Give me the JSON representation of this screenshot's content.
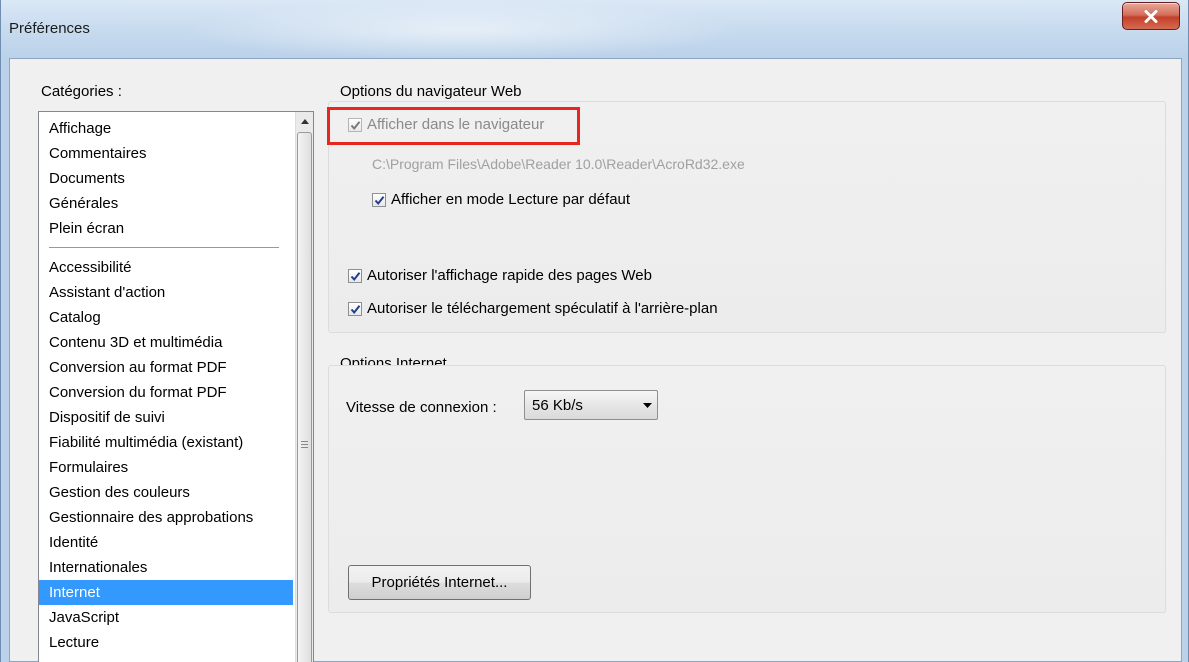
{
  "window": {
    "title": "Préférences"
  },
  "categories": {
    "label": "Catégories :",
    "group1": [
      "Affichage",
      "Commentaires",
      "Documents",
      "Générales",
      "Plein écran"
    ],
    "group2": [
      "Accessibilité",
      "Assistant d'action",
      "Catalog",
      "Contenu 3D et multimédia",
      "Conversion au format PDF",
      "Conversion du format PDF",
      "Dispositif de suivi",
      "Fiabilité multimédia (existant)",
      "Formulaires",
      "Gestion des couleurs",
      "Gestionnaire des approbations",
      "Identité",
      "Internationales",
      "Internet",
      "JavaScript",
      "Lecture"
    ],
    "selected": "Internet"
  },
  "browser_options": {
    "title": "Options du navigateur Web",
    "show_in_browser": {
      "label": "Afficher dans le navigateur",
      "checked": true,
      "disabled": true
    },
    "path": "C:\\Program Files\\Adobe\\Reader 10.0\\Reader\\AcroRd32.exe",
    "read_mode": {
      "label": "Afficher en mode Lecture par défaut",
      "checked": true
    },
    "fast_web_view": {
      "label": "Autoriser l'affichage rapide des pages Web",
      "checked": true
    },
    "speculative_download": {
      "label": "Autoriser le téléchargement spéculatif à l'arrière-plan",
      "checked": true
    }
  },
  "internet_options": {
    "title": "Options Internet",
    "speed_label": "Vitesse de connexion :",
    "speed_value": "56 Kb/s",
    "properties_button": "Propriétés Internet..."
  },
  "colors": {
    "selection": "#3399ff",
    "highlight_box": "#e8261f"
  }
}
